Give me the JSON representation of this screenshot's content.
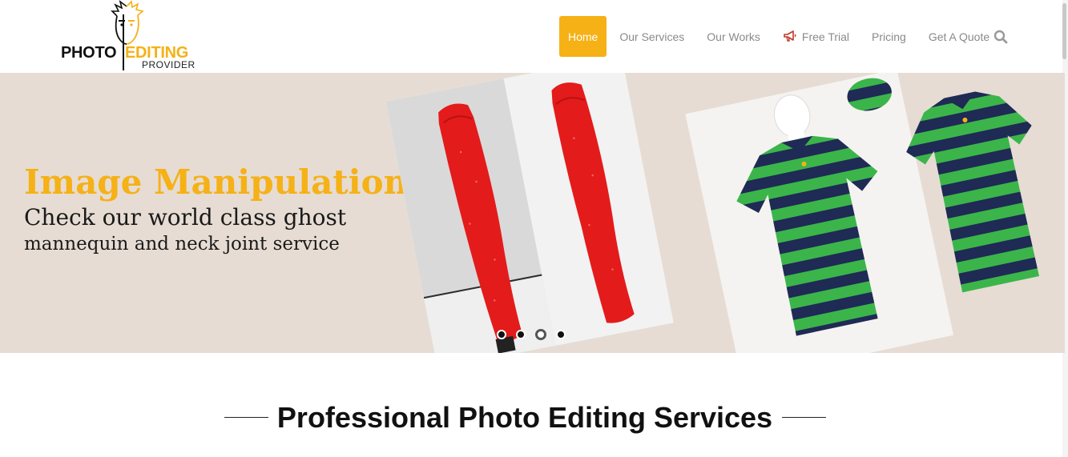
{
  "logo": {
    "word_photo": "PHOTO",
    "word_editing": "EDITING",
    "word_provider": "PROVIDER"
  },
  "nav": {
    "items": [
      {
        "label": "Home",
        "active": true
      },
      {
        "label": "Our Services",
        "active": false
      },
      {
        "label": "Our Works",
        "active": false
      },
      {
        "label": "Free Trial",
        "active": false,
        "icon": "megaphone-icon"
      },
      {
        "label": "Pricing",
        "active": false
      },
      {
        "label": "Get A Quote",
        "active": false
      }
    ],
    "search_icon": "search-icon"
  },
  "hero": {
    "title": "Image Manipulation",
    "line1": "Check our world class ghost",
    "line2": "mannequin and neck joint service",
    "slides_total": 4,
    "active_slide": 3
  },
  "section": {
    "title": "Professional Photo Editing Services"
  },
  "colors": {
    "accent": "#f5b116",
    "hero_bg": "#e6dcd3",
    "nav_text": "#8a8a8a",
    "shirt_green": "#3bb54a",
    "shirt_navy": "#1f2a55",
    "dress_red": "#e41b1b"
  }
}
